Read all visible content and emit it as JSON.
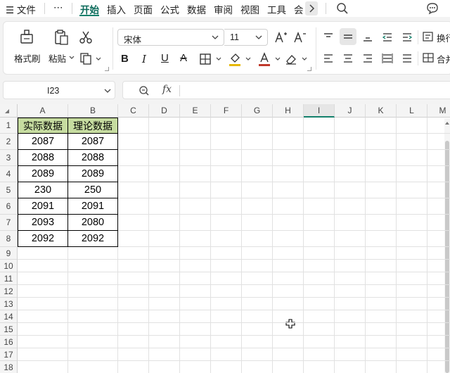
{
  "menubar": {
    "file": "文件",
    "more": "⋯",
    "tabs": [
      "开始",
      "插入",
      "页面",
      "公式",
      "数据",
      "审阅",
      "视图",
      "工具",
      "会"
    ]
  },
  "ribbon": {
    "format_painter": "格式刷",
    "paste": "粘贴",
    "font_name": "宋体",
    "font_size": "11",
    "wrap_text": "换行",
    "merge": "合并"
  },
  "formula_bar": {
    "name_box": "I23",
    "fx": "fx",
    "formula": ""
  },
  "sheet": {
    "columns": [
      "A",
      "B",
      "C",
      "D",
      "E",
      "F",
      "G",
      "H",
      "I",
      "J",
      "K",
      "L",
      "M"
    ],
    "rows": [
      "1",
      "2",
      "3",
      "4",
      "5",
      "6",
      "7",
      "8",
      "9",
      "10",
      "11",
      "12",
      "13",
      "14",
      "15",
      "16",
      "17",
      "18"
    ],
    "headers": [
      "实际数据",
      "理论数据"
    ],
    "data": [
      [
        "2087",
        "2087"
      ],
      [
        "2088",
        "2088"
      ],
      [
        "2089",
        "2089"
      ],
      [
        "230",
        "250"
      ],
      [
        "2091",
        "2091"
      ],
      [
        "2093",
        "2080"
      ],
      [
        "2092",
        "2092"
      ]
    ]
  },
  "colors": {
    "accent": "#13806b",
    "header_fill": "#c6dca0",
    "font_color_bar": "#c0392b",
    "fill_color_bar": "#e6b800"
  }
}
